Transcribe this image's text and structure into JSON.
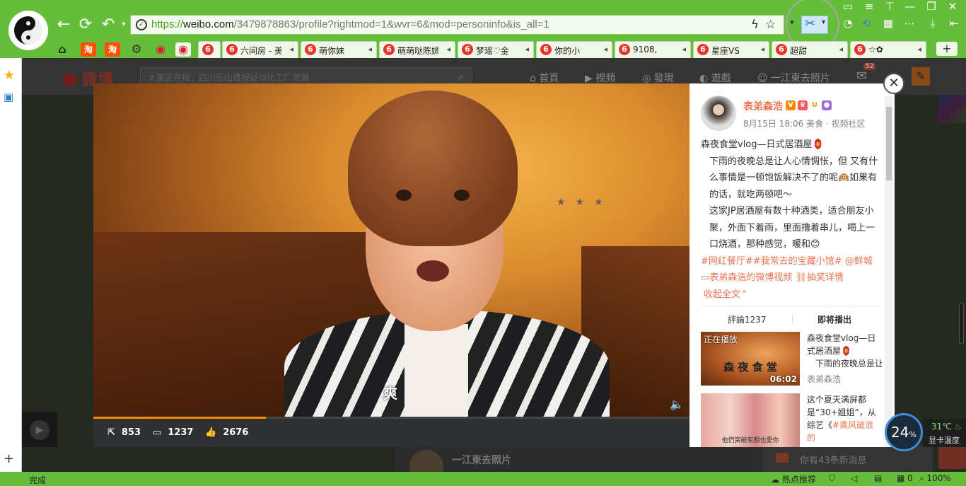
{
  "browser": {
    "url_scheme": "https://",
    "url_domain": "weibo.com",
    "url_path": "/3479878863/profile?rightmod=1&wvr=6&mod=personinfo&is_all=1",
    "accent": "#66bd3c",
    "tabs": [
      {
        "favicon": "6",
        "title": "六间房 - 美"
      },
      {
        "favicon": "6",
        "title": "萌你妹"
      },
      {
        "favicon": "6",
        "title": "萌萌哒陈嫣"
      },
      {
        "favicon": "6",
        "title": "梦瑶♡金"
      },
      {
        "favicon": "6",
        "title": "你的小"
      },
      {
        "favicon": "6",
        "title": "9108,"
      },
      {
        "favicon": "6",
        "title": "星座VS"
      },
      {
        "favicon": "6",
        "title": "超甜"
      },
      {
        "favicon": "6",
        "title": "☆✿"
      }
    ],
    "pinned_icons": [
      "home-icon",
      "taobao-icon",
      "taobao-icon",
      "settings-icon",
      "weibo-icon",
      "weibo-icon"
    ],
    "pinned_labels": {
      "taobao": "淘"
    },
    "new_tab": "+",
    "status_done": "完成",
    "status_hot": "热点推荐",
    "status_count": "0",
    "zoom": "100%"
  },
  "weibo": {
    "logo_text": "微博",
    "search_placeholder": "大家正在搜：四川乐山遭报疑似化工厂泄漏",
    "nav": [
      "首頁",
      "視頻",
      "發現",
      "遊戲",
      "一江東去照片"
    ],
    "msg_badge": "52",
    "bottom_card_name": "一江東去照片",
    "msg_notice": "你有43条新消息"
  },
  "video": {
    "caption": "爽",
    "progress_percent": 29,
    "stats": {
      "shares": "853",
      "comments": "1237",
      "likes": "2676"
    }
  },
  "post": {
    "author": "表弟森浩",
    "meta": "8月15日 18:06 美食 · 视频社区",
    "title": "森夜食堂vlog—日式居酒屋🏮",
    "para1": "下雨的夜晚总是让人心情惆怅，但 又有什么事情是一顿饱饭解决不了的呢🙉如果有的话，就吃两顿吧～",
    "para2": "这家JP居酒屋有数十种酒类，适合朋友小聚，外面下着雨，里面撸着串儿，喝上一口烧酒，那种感觉，暖和😊",
    "tags": "#网红餐厅##我常去的宝藏小馆# @鲜城",
    "video_link": "表弟森浩的微博视频",
    "lottery_link": "抽奖详情",
    "collapse": "收起全文",
    "tab_comments": "評論1237",
    "tab_next": "即将播出"
  },
  "recommendations": [
    {
      "playing_label": "正在播放",
      "thumb_caption": "森 夜 食 堂",
      "duration": "06:02",
      "title": "森夜食堂vlog—日式居酒屋🏮",
      "desc": "下雨的夜晚总是让人心情惆怅",
      "author": "表弟森浩"
    },
    {
      "thumb_caption": "他們突破有顏也愛你",
      "title_plain": "这个夏天满屏都是“30+姐姐”，从综艺《",
      "title_tag": "#乘风破浪的"
    }
  ],
  "system": {
    "gauge_value": "24",
    "gauge_unit": "%",
    "temperature": "31℃",
    "temperature_label": "显卡温度"
  }
}
